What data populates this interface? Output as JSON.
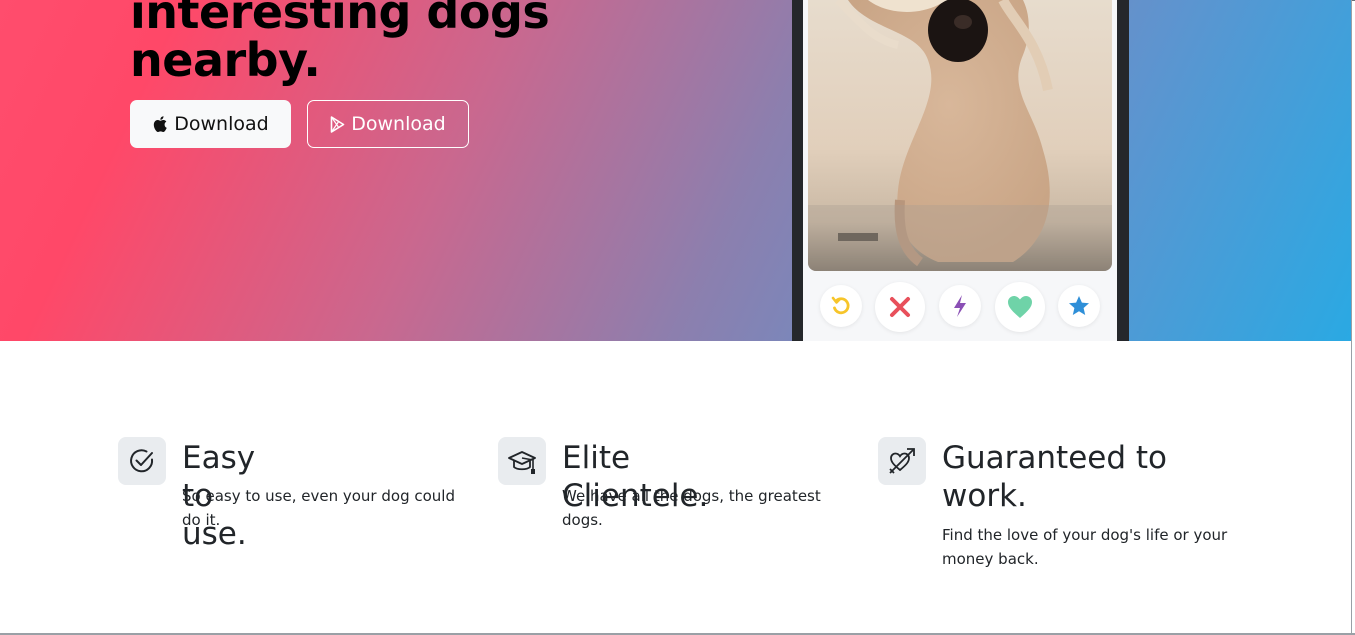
{
  "hero": {
    "headline_line1": "interesting dogs",
    "headline_line2": "nearby.",
    "buttons": {
      "apple_label": "Download",
      "play_label": "Download"
    },
    "gradient_colors": [
      "#ff4868",
      "#c9688f",
      "#8c7fae",
      "#2aa9e3"
    ]
  },
  "phone": {
    "photo_alt": "dog photo",
    "actions": [
      {
        "icon": "undo-icon",
        "color": "#f7c52a"
      },
      {
        "icon": "close-icon",
        "color": "#e8505b"
      },
      {
        "icon": "lightning-icon",
        "color": "#8a4fb5"
      },
      {
        "icon": "heart-icon",
        "color": "#6fd3a8"
      },
      {
        "icon": "star-icon",
        "color": "#2f8fd8"
      }
    ]
  },
  "features": [
    {
      "icon": "check-circle-icon",
      "title": "Easy to use.",
      "text": "So easy to use, even your dog could do it."
    },
    {
      "icon": "graduation-cap-icon",
      "title": "Elite Clientele.",
      "text": "We have all the dogs, the greatest dogs."
    },
    {
      "icon": "heart-arrow-icon",
      "title": "Guaranteed to work.",
      "text": "Find the love of your dog's life or your money back."
    }
  ]
}
